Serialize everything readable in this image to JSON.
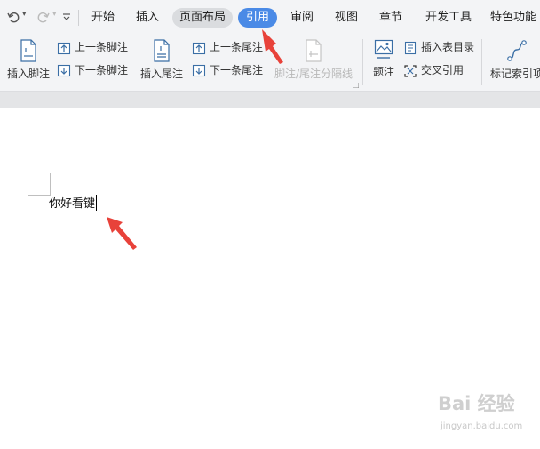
{
  "quick_access": {
    "undo_icon": "undo-icon",
    "redo_icon": "redo-icon",
    "dropdown_glyph": "▾",
    "more_glyph": "⩒"
  },
  "tabs": [
    {
      "label": "开始"
    },
    {
      "label": "插入"
    },
    {
      "label": "页面布局"
    },
    {
      "label": "引用"
    },
    {
      "label": "审阅"
    },
    {
      "label": "视图"
    },
    {
      "label": "章节"
    },
    {
      "label": "开发工具"
    },
    {
      "label": "特色功能"
    }
  ],
  "active_tab": "引用",
  "ribbon": {
    "insert_footnote": "插入脚注",
    "prev_footnote": "上一条脚注",
    "next_footnote": "下一条脚注",
    "insert_endnote": "插入尾注",
    "prev_endnote": "上一条尾注",
    "next_endnote": "下一条尾注",
    "footnote_separator": "脚注/尾注分隔线",
    "caption": "题注",
    "insert_toc": "插入表目录",
    "cross_reference": "交叉引用",
    "mark_index": "标记索引项"
  },
  "document": {
    "text": "你好看键"
  },
  "watermark": {
    "brand": "Bai 经验",
    "url": "jingyan.baidu.com"
  },
  "colors": {
    "active_tab": "#4a8ae6",
    "annotation_arrow": "#e8423a",
    "ribbon_bg": "#f3f4f6"
  }
}
